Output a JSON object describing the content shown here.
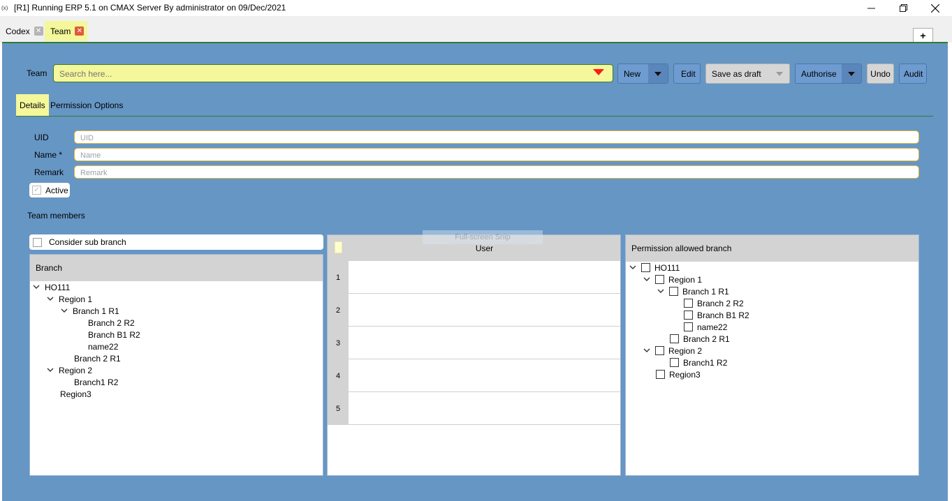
{
  "window": {
    "icon": "(x)",
    "title": "[R1] Running ERP 5.1 on CMAX Server By administrator on 09/Dec/2021",
    "minimize_icon": "minimize-icon",
    "maximize_icon": "restore-icon",
    "close_icon": "close-icon"
  },
  "tabs": [
    {
      "label": "Codex",
      "close": "✕"
    },
    {
      "label": "Team",
      "close": "✕"
    }
  ],
  "add_tab_label": "+",
  "toolbar": {
    "team_label": "Team",
    "search_placeholder": "Search here...",
    "new_label": "New",
    "edit_label": "Edit",
    "save_draft_label": "Save as draft",
    "authorise_label": "Authorise",
    "undo_label": "Undo",
    "audit_label": "Audit"
  },
  "inner_tabs": [
    "Details",
    "Permission",
    "Options"
  ],
  "form": {
    "uid_label": "UID",
    "uid_placeholder": "UID",
    "name_label": "Name *",
    "name_placeholder": "Name",
    "remark_label": "Remark",
    "remark_placeholder": "Remark",
    "active_label": "Active",
    "active_checked": true,
    "active_check_glyph": "✓"
  },
  "team_members_label": "Team members",
  "branch_panel": {
    "consider_sub_branch_label": "Consider sub branch",
    "header": "Branch",
    "tree": [
      "HO111",
      "Region 1",
      "Branch 1 R1",
      "Branch 2 R2",
      "Branch B1 R2",
      "name22",
      "Branch 2 R1",
      "Region 2",
      "Branch1 R2",
      "Region3"
    ]
  },
  "user_grid": {
    "header": "User",
    "rows": [
      "1",
      "2",
      "3",
      "4",
      "5"
    ]
  },
  "ghost_overlay_text": "Full-screen Snip",
  "permission_panel": {
    "header": "Permission allowed branch",
    "tree": [
      "HO111",
      "Region 1",
      "Branch 1 R1",
      "Branch 2 R2",
      "Branch B1 R2",
      "name22",
      "Branch 2 R1",
      "Region 2",
      "Branch1 R2",
      "Region3"
    ]
  },
  "colors": {
    "panel_bg": "#6696c4",
    "search_bg": "#f4f79a",
    "active_tab_bg": "#f4f79a",
    "accent_line": "#2e7d32",
    "caret": "#ff1a1a"
  }
}
